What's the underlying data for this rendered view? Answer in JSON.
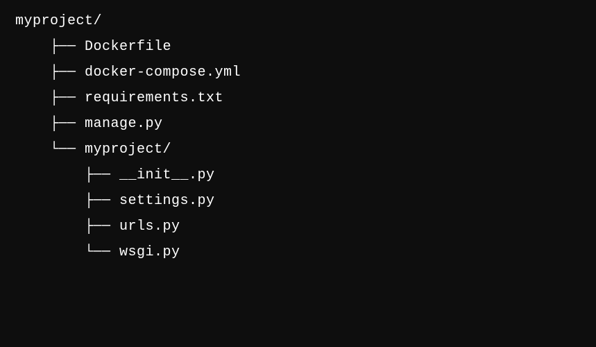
{
  "tree": {
    "lines": [
      "myproject/",
      "    ├── Dockerfile",
      "    ├── docker-compose.yml",
      "    ├── requirements.txt",
      "    ├── manage.py",
      "    └── myproject/",
      "        ├── __init__.py",
      "        ├── settings.py",
      "        ├── urls.py",
      "        └── wsgi.py"
    ]
  }
}
